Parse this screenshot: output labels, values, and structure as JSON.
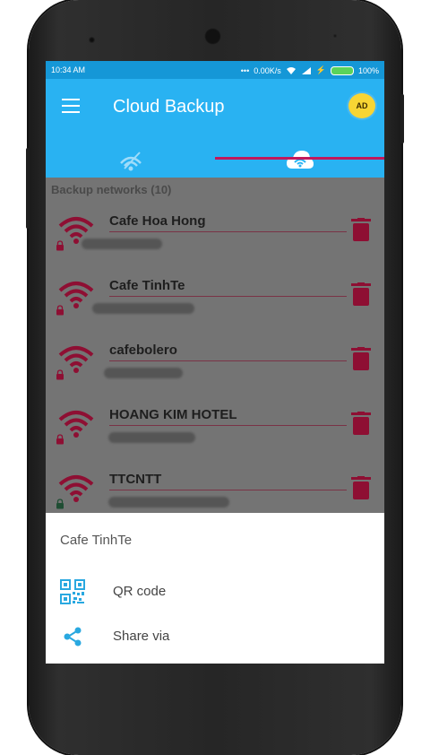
{
  "status_bar": {
    "time": "10:34 AM",
    "speed": "0.00K/s",
    "battery": "100%"
  },
  "app_bar": {
    "title": "Cloud Backup",
    "ad_badge": "AD"
  },
  "section": {
    "header": "Backup networks (10)"
  },
  "networks": [
    {
      "ssid": "Cafe Hoa Hong"
    },
    {
      "ssid": "Cafe TinhTe"
    },
    {
      "ssid": "cafebolero"
    },
    {
      "ssid": "HOANG KIM HOTEL"
    },
    {
      "ssid": "TTCNTT"
    }
  ],
  "bottom_sheet": {
    "title": "Cafe TinhTe",
    "items": [
      {
        "label": "QR code",
        "icon": "qr-code-icon"
      },
      {
        "label": "Share via",
        "icon": "share-icon"
      }
    ]
  },
  "colors": {
    "app_bar": "#29b2f2",
    "status_bar": "#1597d7",
    "accent": "#c2185b",
    "icon_red": "#8e0f33",
    "sheet_icon": "#29a8e0"
  }
}
